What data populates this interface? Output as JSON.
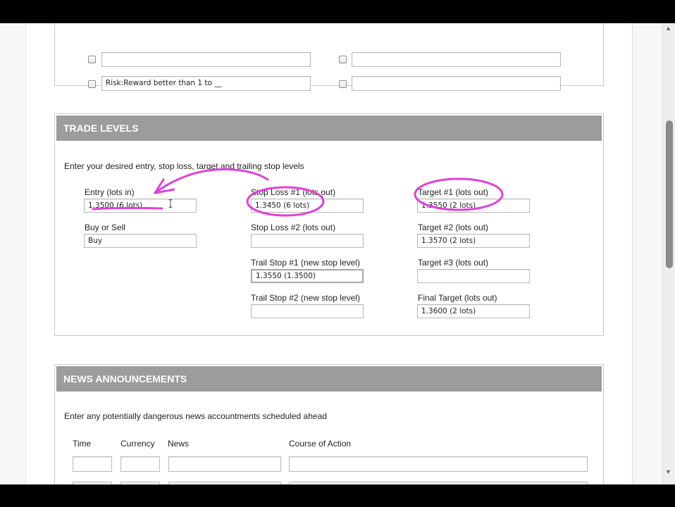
{
  "criteria": {
    "rows": [
      {
        "left_text": "",
        "right_text": ""
      },
      {
        "left_text": "Risk:Reward better than 1 to __",
        "right_text": ""
      }
    ]
  },
  "trade_levels": {
    "title": "TRADE LEVELS",
    "intro": "Enter your desired entry, stop loss, target and trailing stop levels",
    "entry": {
      "label": "Entry (lots in)",
      "value": "1.3500 (6 lots)"
    },
    "buy_sell": {
      "label": "Buy or Sell",
      "value": "Buy"
    },
    "stop_loss_1": {
      "label": "Stop Loss #1 (lots out)",
      "value": "1.3450 (6 lots)"
    },
    "stop_loss_2": {
      "label": "Stop Loss #2 (lots out)",
      "value": ""
    },
    "trail_stop_1": {
      "label": "Trail Stop #1 (new stop level)",
      "value": "1.3550 (1.3500)"
    },
    "trail_stop_2": {
      "label": "Trail Stop #2 (new stop level)",
      "value": ""
    },
    "target_1": {
      "label": "Target #1 (lots out)",
      "value": "1.3550 (2 lots)"
    },
    "target_2": {
      "label": "Target #2 (lots out)",
      "value": "1.3570 (2 lots)"
    },
    "target_3": {
      "label": "Target #3 (lots out)",
      "value": ""
    },
    "final_target": {
      "label": "Final Target (lots out)",
      "value": "1.3600 (2 lots)"
    }
  },
  "news": {
    "title": "NEWS ANNOUNCEMENTS",
    "intro": "Enter any potentially dangerous news accountments scheduled ahead",
    "columns": [
      "Time",
      "Currency",
      "News",
      "Course of Action"
    ]
  },
  "colors": {
    "annotation": "#e040d8",
    "header_bg": "#9c9c9c"
  }
}
